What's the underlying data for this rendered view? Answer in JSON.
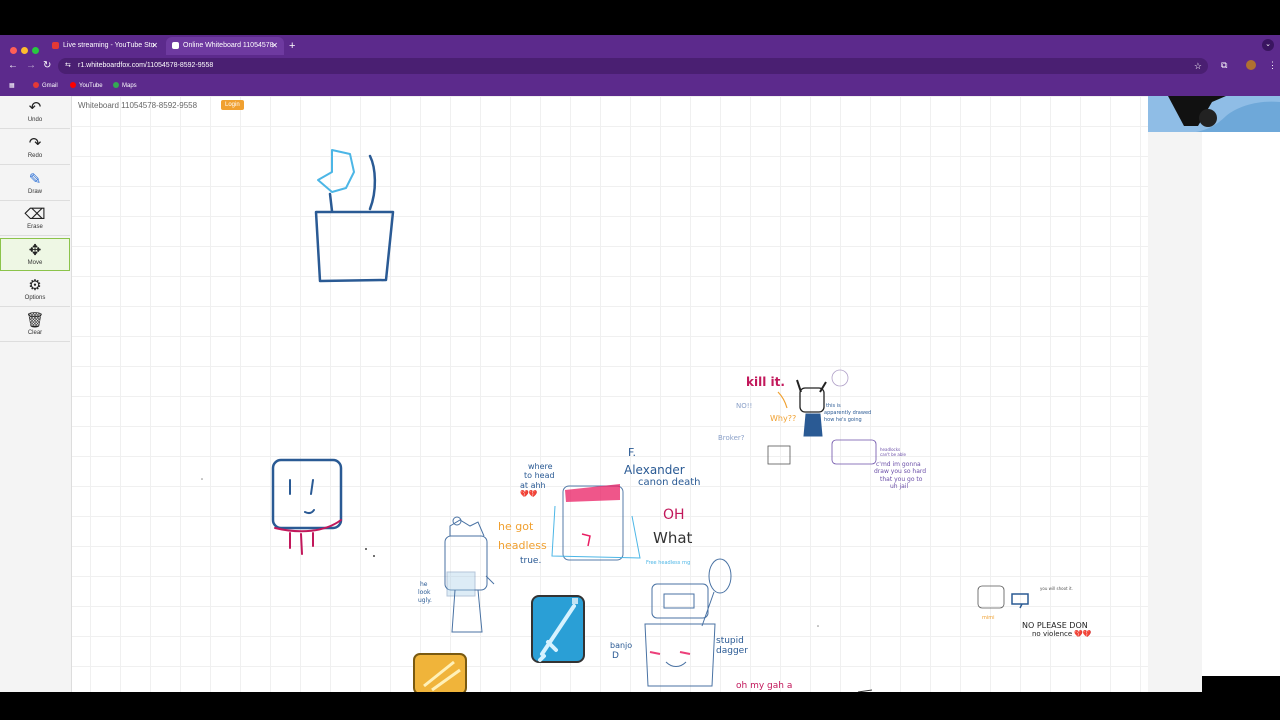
{
  "browser": {
    "tabs": [
      {
        "label": "Live streaming - YouTube Stu",
        "active": false,
        "favicon_color": "#e53935"
      },
      {
        "label": "Online Whiteboard 11054578",
        "active": true,
        "favicon_color": "#ffffff"
      }
    ],
    "new_tab": "+",
    "url": "r1.whiteboardfox.com/11054578-8592-9558",
    "bookmarks": [
      "Gmail",
      "YouTube",
      "Maps"
    ],
    "theme_color": "#5c2a8c"
  },
  "whiteboard": {
    "title": "Whiteboard 11054578-8592-9558",
    "login": "Login",
    "tools": [
      {
        "label": "Undo",
        "icon": "undo-icon",
        "glyph": "↶"
      },
      {
        "label": "Redo",
        "icon": "redo-icon",
        "glyph": "↷"
      },
      {
        "label": "Draw",
        "icon": "pencil-icon",
        "glyph": "✎"
      },
      {
        "label": "Erase",
        "icon": "eraser-icon",
        "glyph": "⌫"
      },
      {
        "label": "Move",
        "icon": "move-icon",
        "glyph": "✥"
      },
      {
        "label": "Options",
        "icon": "gear-icon",
        "glyph": "⚙"
      },
      {
        "label": "Clear",
        "icon": "trash-icon",
        "glyph": "🗑"
      }
    ],
    "active_tool": "Move",
    "drawing_text": {
      "kill_it": "kill it.",
      "why": "Why??",
      "no": "NO!!",
      "broker": "Broker?",
      "this_is": "this is",
      "apparently": "apparently drawed",
      "how_hes_going": "how he's going",
      "headlocks": "headlocks",
      "cant_be": "can't be able",
      "cm_gonna": "c'md im gonna",
      "draw_you": "draw you so hard",
      "that_you": "that you go to",
      "jail": "uh jail",
      "where_head": "where",
      "where_head2": "to head",
      "at_ahh": "at ahh",
      "f": "F.",
      "alexander": "Alexander",
      "canon_death": "canon death",
      "oh": "OH",
      "what": "What",
      "he_got": "he got",
      "headless": "headless",
      "true": "true.",
      "free_headless": "Free headless rng",
      "he_look": "he",
      "look": "look",
      "ugly": "ugly.",
      "banjo": "banjo",
      "d": "D",
      "stupid": "stupid",
      "dagger": "dagger",
      "oh_my_gah": "oh my gah a",
      "you_will": "you will shoot it.",
      "mimi": "mimi",
      "no_please": "NO PLEASE DON",
      "no_violence": "no violence",
      "hearts": "💔💔"
    },
    "colors": {
      "blue": "#2a5a94",
      "light_blue": "#4cb6e6",
      "magenta": "#c2185b",
      "orange": "#f0a030",
      "purple": "#6b4fa8"
    }
  }
}
